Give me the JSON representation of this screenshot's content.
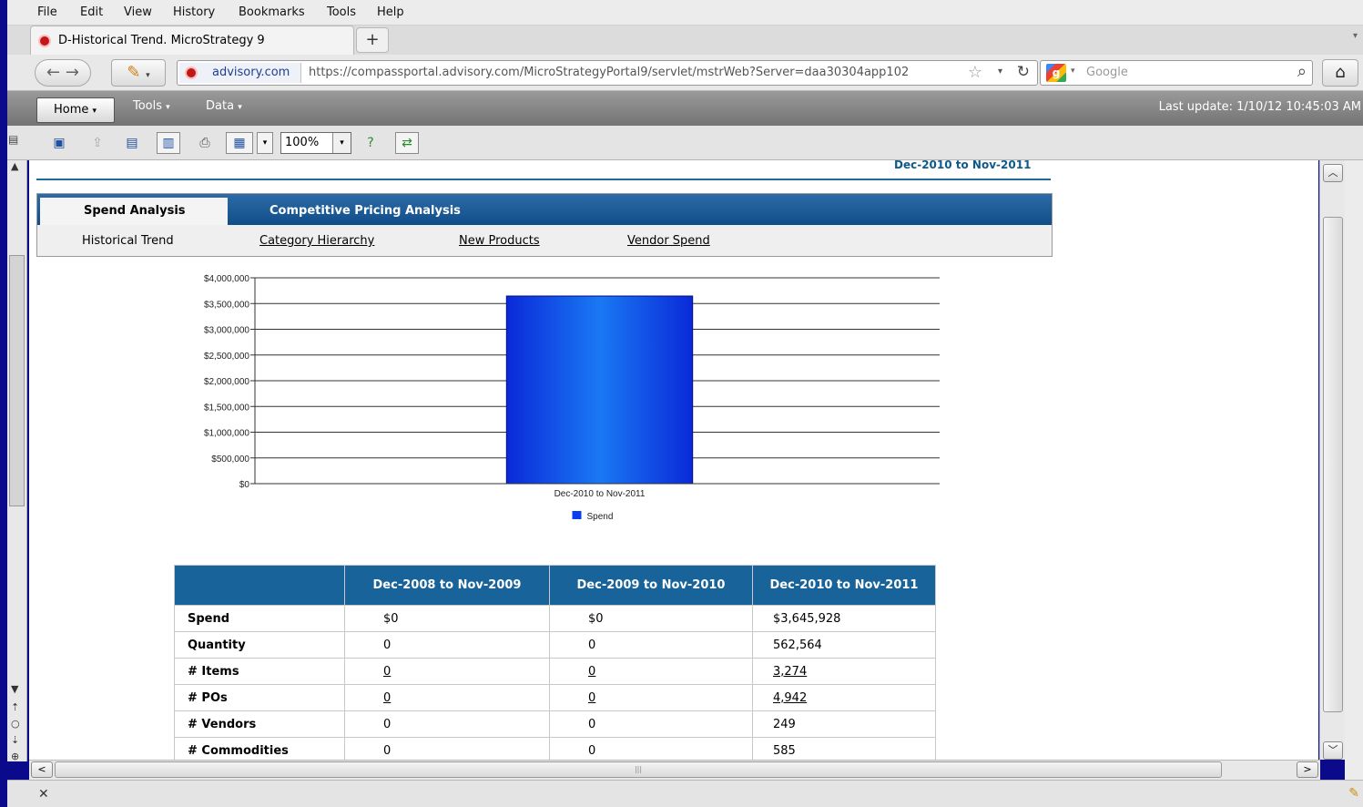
{
  "browser": {
    "menu": [
      "File",
      "Edit",
      "View",
      "History",
      "Bookmarks",
      "Tools",
      "Help"
    ],
    "tab_title": "D-Historical Trend. MicroStrategy 9",
    "new_tab": "+",
    "site_identity": "advisory.com",
    "url": "https://compassportal.advisory.com/MicroStrategyPortal9/servlet/mstrWeb?Server=daa30304app102",
    "search_placeholder": "Google"
  },
  "app": {
    "menus": [
      "Home",
      "Tools",
      "Data"
    ],
    "last_update": "Last update: 1/10/12 10:45:03 AM",
    "zoom": "100%"
  },
  "report": {
    "header_period": "Dec-2010 to Nov-2011",
    "tabs": [
      "Spend Analysis",
      "Competitive Pricing Analysis"
    ],
    "subnav": [
      "Historical Trend",
      "Category Hierarchy",
      "New Products",
      "Vendor Spend"
    ]
  },
  "chart_data": {
    "type": "bar",
    "categories": [
      "Dec-2010 to Nov-2011"
    ],
    "series": [
      {
        "name": "Spend",
        "values": [
          3645928
        ]
      }
    ],
    "ylim": [
      0,
      4000000
    ],
    "yticks": [
      "$0",
      "$500,000",
      "$1,000,000",
      "$1,500,000",
      "$2,000,000",
      "$2,500,000",
      "$3,000,000",
      "$3,500,000",
      "$4,000,000"
    ],
    "grid": true,
    "legend": "bottom",
    "colors": [
      "#0a3cf0"
    ]
  },
  "table": {
    "columns": [
      "",
      "Dec-2008 to Nov-2009",
      "Dec-2009 to Nov-2010",
      "Dec-2010 to Nov-2011"
    ],
    "rows": [
      {
        "label": "Spend",
        "values": [
          "$0",
          "$0",
          "$3,645,928"
        ]
      },
      {
        "label": "Quantity",
        "values": [
          "0",
          "0",
          "562,564"
        ]
      },
      {
        "label": "# Items",
        "values": [
          "0",
          "0",
          "3,274"
        ]
      },
      {
        "label": "# POs",
        "values": [
          "0",
          "0",
          "4,942"
        ]
      },
      {
        "label": "# Vendors",
        "values": [
          "0",
          "0",
          "249"
        ]
      },
      {
        "label": "# Commodities",
        "values": [
          "0",
          "0",
          "585"
        ]
      }
    ]
  }
}
